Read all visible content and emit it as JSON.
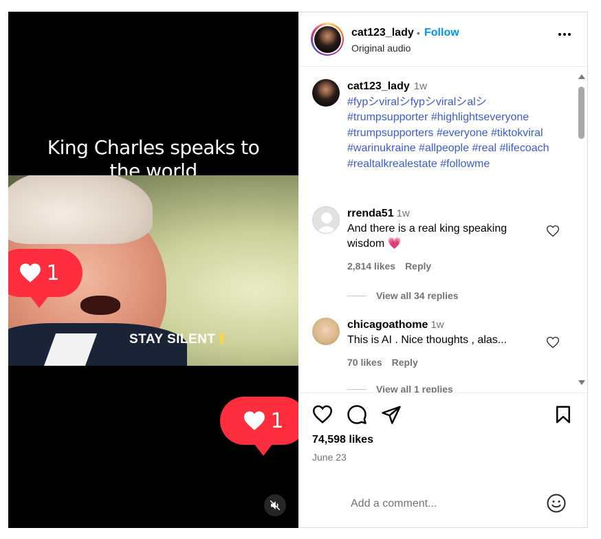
{
  "video": {
    "caption_line1": "King Charles speaks to",
    "caption_line2": "the world",
    "subtitle": "STAY SILENT",
    "like_bubbles": [
      {
        "count": "1"
      },
      {
        "count": "1"
      }
    ],
    "muted": true
  },
  "header": {
    "username": "cat123_lady",
    "separator": "•",
    "follow_label": "Follow",
    "audio_label": "Original audio"
  },
  "caption": {
    "username": "cat123_lady",
    "time": "1w",
    "hashtags": "#fypシviralシfypシviralシalシ #trumpsupporter #highlightseveryone #trumpsupporters #everyone #tiktokviral #warinukraine #allpeople #real #lifecoach #realtalkrealestate #followme"
  },
  "comments": [
    {
      "username": "rrenda51",
      "time": "1w",
      "text": "And there is a real king speaking wisdom 💗",
      "likes": "2,814 likes",
      "reply_label": "Reply",
      "view_replies": "View all 34 replies"
    },
    {
      "username": "chicagoathome",
      "time": "1w",
      "text": "This is AI . Nice thoughts , alas...",
      "likes": "70 likes",
      "reply_label": "Reply",
      "view_replies": "View all 1 replies"
    }
  ],
  "actions": {
    "likes_count": "74,598 likes",
    "date": "June 23"
  },
  "add_comment": {
    "placeholder": "Add a comment..."
  },
  "colors": {
    "follow_blue": "#0095f6",
    "hashtag_blue": "#3a5bd9",
    "like_red": "#ff2e3e",
    "meta_gray": "#737373"
  }
}
